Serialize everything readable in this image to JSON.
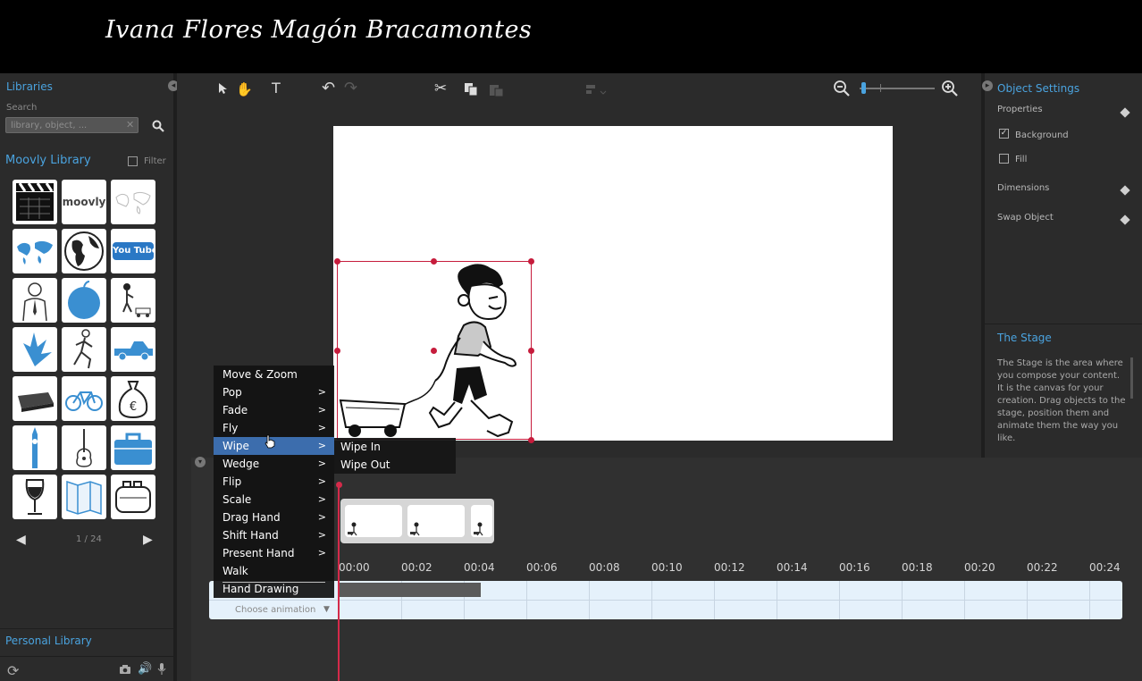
{
  "title": "Ivana Flores Magón Bracamontes",
  "libraries": {
    "header": "Libraries",
    "search_label": "Search",
    "search_placeholder": "library, object, ...",
    "moovly_library": "Moovly Library",
    "filter": "Filter",
    "pagination": "1 / 24",
    "personal_library": "Personal Library",
    "thumb_moovly_text": "moovly",
    "thumb_youtube_text": "You Tube",
    "thumbnails": [
      "clapperboard-icon",
      "moovly-logo",
      "world-map-outline",
      "world-map-blue",
      "globe-icon",
      "youtube-logo",
      "businessman-icon",
      "apple-icon",
      "boy-with-wagon",
      "banana-icon",
      "running-man-icon",
      "pickup-truck-icon",
      "briefcase-icon",
      "bicycle-icon",
      "money-bag-icon",
      "big-ben-icon",
      "guitar-icon",
      "toolbox-icon",
      "wine-glass-icon",
      "folded-map-icon",
      "toaster-icon"
    ]
  },
  "object_settings": {
    "header": "Object Settings",
    "properties": "Properties",
    "background": "Background",
    "fill": "Fill",
    "dimensions": "Dimensions",
    "swap_object": "Swap Object",
    "background_checked": true,
    "fill_checked": false
  },
  "stage_info": {
    "header": "The Stage",
    "text": "The Stage is the area where you compose your content. It is the canvas for your creation. Drag objects to the stage, position them and animate them the way you like."
  },
  "zoom_level": 0.05,
  "animation_menu": {
    "items": [
      {
        "label": "Move & Zoom",
        "submenu": false
      },
      {
        "label": "Pop",
        "submenu": true
      },
      {
        "label": "Fade",
        "submenu": true
      },
      {
        "label": "Fly",
        "submenu": true
      },
      {
        "label": "Wipe",
        "submenu": true
      },
      {
        "label": "Wedge",
        "submenu": true
      },
      {
        "label": "Flip",
        "submenu": true
      },
      {
        "label": "Scale",
        "submenu": true
      },
      {
        "label": "Drag Hand",
        "submenu": true
      },
      {
        "label": "Shift Hand",
        "submenu": true
      },
      {
        "label": "Present Hand",
        "submenu": true
      },
      {
        "label": "Walk",
        "submenu": false
      },
      {
        "label": "Hand Drawing",
        "submenu": false
      }
    ],
    "arrow": ">",
    "active": "Wipe",
    "submenu_items": [
      "Wipe In",
      "Wipe Out"
    ]
  },
  "timeline": {
    "ticks": [
      "00:00",
      "00:02",
      "00:04",
      "00:06",
      "00:08",
      "00:10",
      "00:12",
      "00:14",
      "00:16",
      "00:18",
      "00:20",
      "00:22",
      "00:24"
    ],
    "choose_animation": "Choose animation",
    "clip_start_seconds": 0,
    "clip_end_seconds": 4.5,
    "playhead_seconds": 0
  },
  "colors": {
    "accent_blue": "#4aa3df",
    "menu_active": "#3c6dad",
    "selection_red": "#c61c3c",
    "timeline_track": "#e5f1fb"
  }
}
